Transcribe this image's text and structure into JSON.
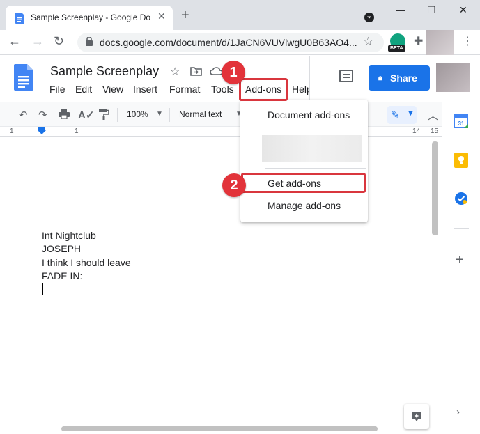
{
  "browser": {
    "tab_title": "Sample Screenplay - Google Docs",
    "url": "docs.google.com/document/d/1JaCN6VUVlwgU0B63AO4...",
    "extension_badge": "BETA"
  },
  "docs": {
    "title": "Sample Screenplay",
    "menu": [
      "File",
      "Edit",
      "View",
      "Insert",
      "Format",
      "Tools",
      "Add-ons",
      "Help"
    ],
    "share_label": "Share",
    "toolbar": {
      "zoom": "100%",
      "style": "Normal text"
    },
    "ruler": {
      "left_numbers": [
        "1",
        "1"
      ],
      "right_numbers": [
        "14",
        "15"
      ]
    },
    "body_lines": [
      "Int Nightclub",
      "JOSEPH",
      "I think I should leave",
      "FADE IN:"
    ]
  },
  "addons_menu": {
    "items": [
      "Document add-ons",
      "Get add-ons",
      "Manage add-ons"
    ]
  },
  "annotations": {
    "step1": "1",
    "step2": "2",
    "highlight_color": "#d9363e"
  },
  "side_panel": {
    "calendar_number": "31"
  },
  "colors": {
    "accent": "#1a73e8",
    "tabstrip": "#dee1e6",
    "badge": "#e2333a"
  }
}
